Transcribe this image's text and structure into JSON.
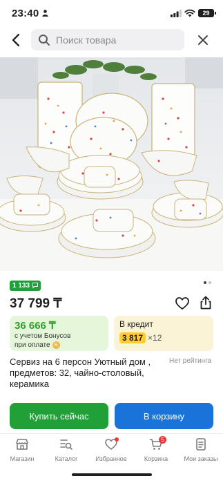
{
  "status_bar": {
    "time": "23:40",
    "battery": "29"
  },
  "search": {
    "placeholder": "Поиск товара"
  },
  "product": {
    "reviews_count": "1 133",
    "price": "37 799 ₸",
    "bonus_price": "36 666 ₸",
    "bonus_text_line1": "с учетом Бонусов",
    "bonus_text_line2": "при оплате",
    "credit_title": "В кредит",
    "credit_amount": "3 817",
    "credit_months": "×12",
    "title": "Сервиз на 6 персон Уютный дом , предметов: 32, чайно-столовый, керамика",
    "rating_text": "Нет рейтинга"
  },
  "actions": {
    "buy_now": "Купить сейчас",
    "add_to_cart": "В корзину"
  },
  "bottom_nav": {
    "items": [
      {
        "label": "Магазин",
        "icon": "shop-icon"
      },
      {
        "label": "Каталог",
        "icon": "catalog-icon"
      },
      {
        "label": "Избранное",
        "icon": "heart-icon"
      },
      {
        "label": "Корзина",
        "icon": "cart-icon",
        "badge": "5"
      },
      {
        "label": "Мои заказы",
        "icon": "orders-icon"
      }
    ]
  },
  "colors": {
    "green": "#21a038",
    "blue": "#1a73d9",
    "bonus_bg": "#e6f6da",
    "credit_bg": "#fbf3d6",
    "credit_highlight": "#ffcc33",
    "badge_red": "#e53935"
  }
}
